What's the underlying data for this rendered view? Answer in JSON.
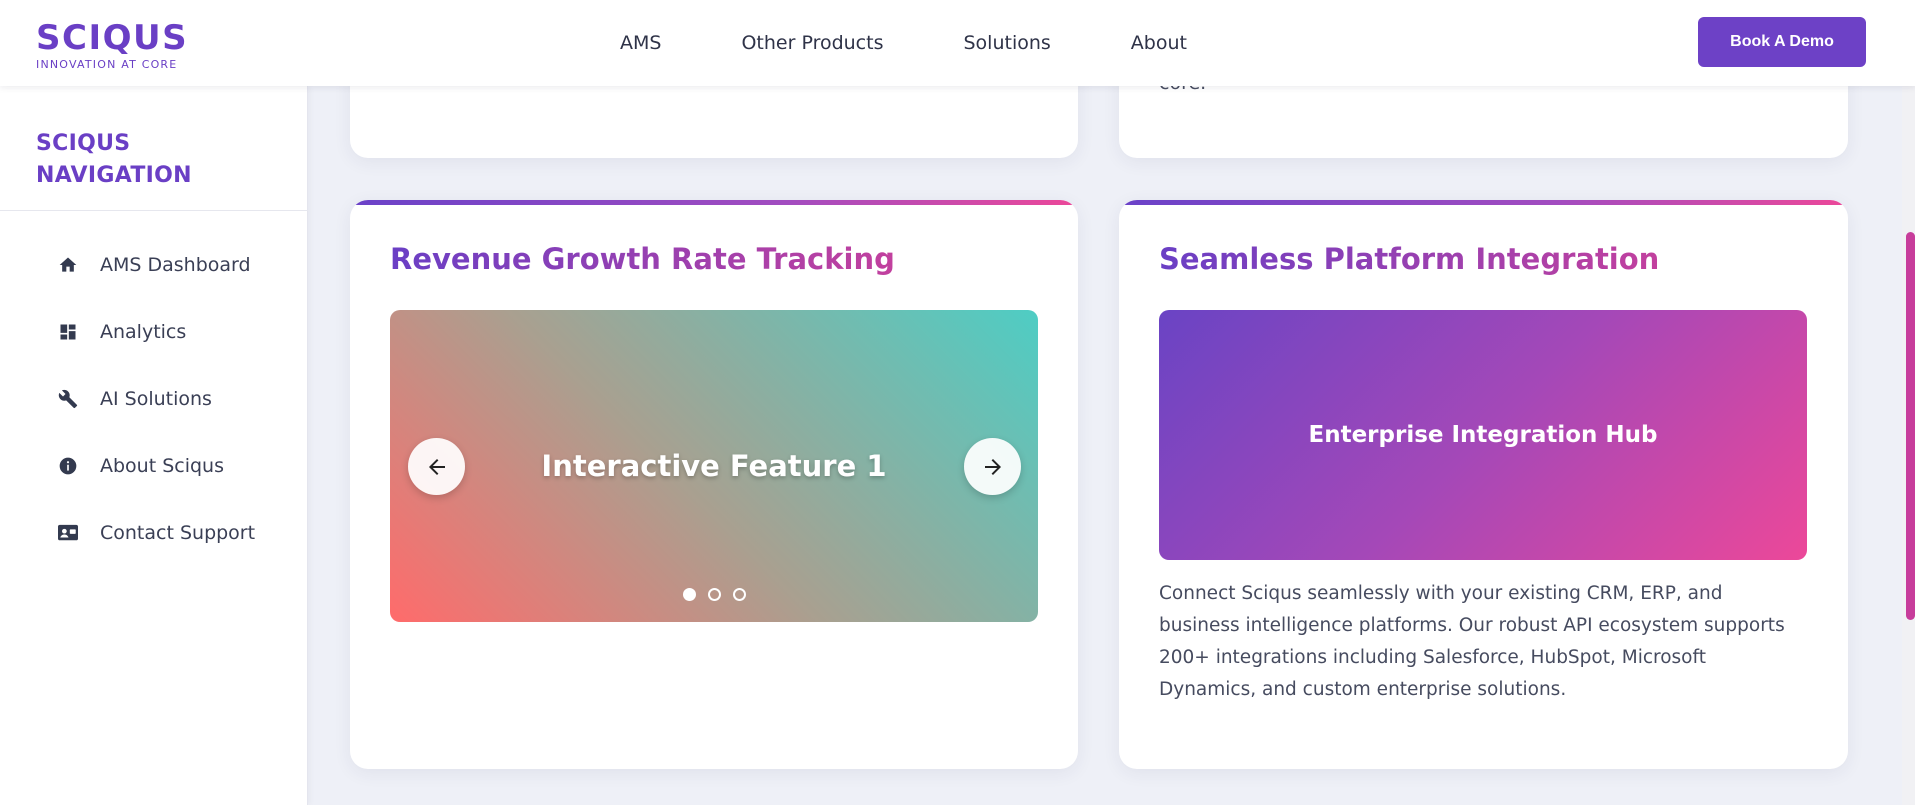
{
  "header": {
    "logo_name": "SCIQUS",
    "logo_tagline": "INNOVATION AT CORE",
    "nav": [
      "AMS",
      "Other Products",
      "Solutions",
      "About"
    ],
    "cta_label": "Book A Demo"
  },
  "sidebar": {
    "title": "SCIQUS NAVIGATION",
    "items": [
      {
        "label": "AMS Dashboard",
        "icon": "home-icon"
      },
      {
        "label": "Analytics",
        "icon": "dashboard-grid-icon"
      },
      {
        "label": "AI Solutions",
        "icon": "wrench-icon"
      },
      {
        "label": "About Sciqus",
        "icon": "info-icon"
      },
      {
        "label": "Contact Support",
        "icon": "contact-card-icon"
      }
    ]
  },
  "previous_card": {
    "text_fragment": "core."
  },
  "cards": [
    {
      "heading": "Revenue Growth Rate Tracking",
      "carousel": {
        "slide_title": "Interactive Feature 1",
        "slide_count": 3,
        "active_index": 0
      }
    },
    {
      "heading": "Seamless Platform Integration",
      "hub_label": "Enterprise Integration Hub",
      "description": "Connect Sciqus seamlessly with your existing CRM, ERP, and business intelligence platforms. Our robust API ecosystem supports 200+ integrations including Salesforce, HubSpot, Microsoft Dynamics, and custom enterprise solutions."
    }
  ],
  "colors": {
    "brand": "#6a3fc5",
    "accent_pink": "#ec4899",
    "cta": "#6d41c6",
    "page_bg": "#eef0f7"
  }
}
